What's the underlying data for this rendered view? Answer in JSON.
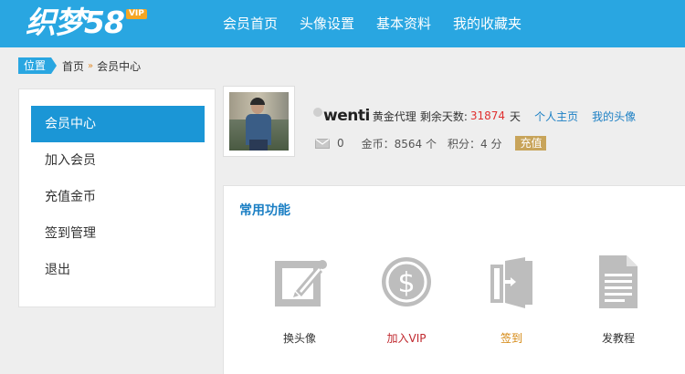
{
  "header": {
    "logo_text": "织梦58",
    "logo_badge": "VIP",
    "nav": [
      "会员首页",
      "头像设置",
      "基本资料",
      "我的收藏夹"
    ]
  },
  "breadcrumb": {
    "tag": "位置",
    "items": [
      "首页",
      "会员中心"
    ],
    "separator": "»"
  },
  "sidebar": {
    "items": [
      {
        "label": "会员中心",
        "active": true
      },
      {
        "label": "加入会员",
        "active": false
      },
      {
        "label": "充值金币",
        "active": false
      },
      {
        "label": "签到管理",
        "active": false
      },
      {
        "label": "退出",
        "active": false
      }
    ]
  },
  "profile": {
    "username": "wenti",
    "member_level": "黄金代理",
    "days_label": "剩余天数:",
    "days_value": "31874",
    "days_unit": "天",
    "links": [
      "个人主页",
      "我的头像"
    ],
    "messages": "0",
    "coins": "金币：8564 个",
    "points": "积分：4 分",
    "recharge_label": "充值"
  },
  "functions": {
    "title": "常用功能",
    "items": [
      {
        "label": "换头像",
        "icon": "edit-icon",
        "color": "#333333"
      },
      {
        "label": "加入VIP",
        "icon": "dollar-coin-icon",
        "color": "#c0282e"
      },
      {
        "label": "签到",
        "icon": "door-icon",
        "color": "#d4860e"
      },
      {
        "label": "发教程",
        "icon": "document-icon",
        "color": "#333333"
      }
    ]
  },
  "colors": {
    "header_bg": "#29a6e1",
    "sidebar_active": "#1b96d6",
    "link": "#1b7fc4",
    "days_value": "#e03030",
    "recharge_bg": "#c8a45a",
    "icon_gray": "#bdbdbd"
  }
}
